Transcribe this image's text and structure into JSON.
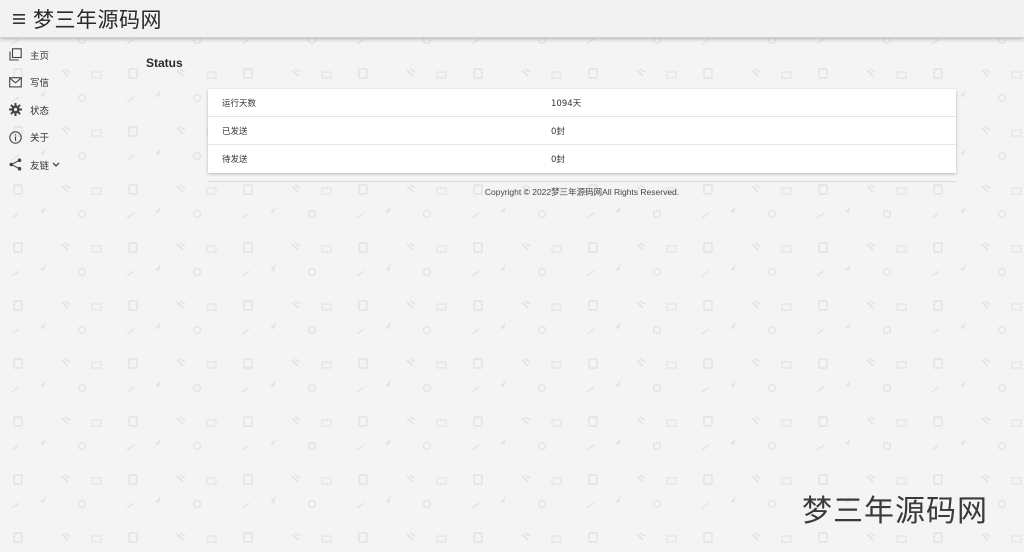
{
  "header": {
    "title": "梦三年源码网"
  },
  "nav": {
    "items": [
      {
        "label": "主页",
        "icon": "pages-icon"
      },
      {
        "label": "写信",
        "icon": "mail-icon"
      },
      {
        "label": "状态",
        "icon": "gear-icon"
      },
      {
        "label": "关于",
        "icon": "info-icon"
      },
      {
        "label": "友链",
        "icon": "share-icon"
      }
    ]
  },
  "main": {
    "title": "Status",
    "rows": [
      {
        "key": "运行天数",
        "value": "1094天"
      },
      {
        "key": "已发送",
        "value": "0封"
      },
      {
        "key": "待发送",
        "value": "0封"
      }
    ]
  },
  "footer": {
    "copyright": "Copyright © 2022梦三年源码网All Rights Reserved."
  },
  "watermark": {
    "text": "梦三年源码网"
  }
}
